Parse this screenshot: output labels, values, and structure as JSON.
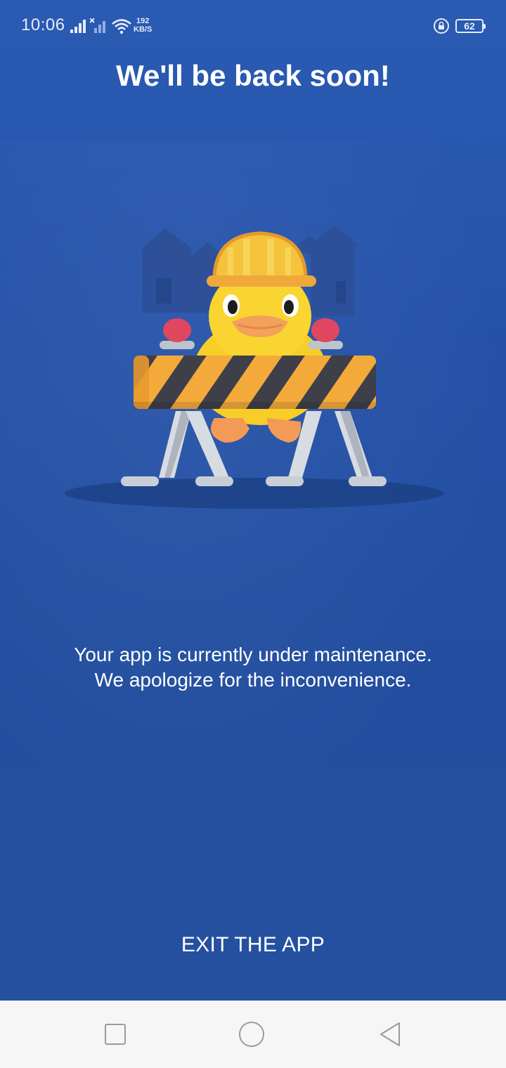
{
  "status_bar": {
    "time": "10:06",
    "network_speed_value": "192",
    "network_speed_unit": "KB/S",
    "battery_level": "62"
  },
  "title": "We'll be back soon!",
  "illustration_icon": "duck-construction-barrier-illustration",
  "message": {
    "line1": "Your app is currently under maintenance.",
    "line2": "We apologize for the inconvenience."
  },
  "exit_label": "EXIT THE APP",
  "nav_bar": {
    "recents_icon": "square-icon",
    "home_icon": "circle-icon",
    "back_icon": "triangle-back-icon"
  },
  "colors": {
    "background": "#2552a8",
    "text": "#ffffff",
    "nav_bar": "#f6f6f6"
  }
}
